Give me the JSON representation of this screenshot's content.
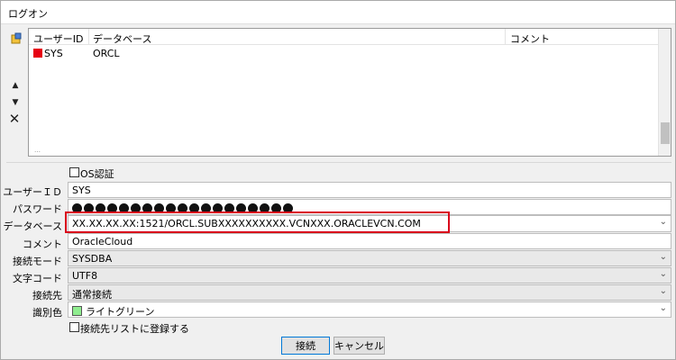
{
  "window": {
    "title": "ログオン"
  },
  "side_tools": {
    "move_up": "▲",
    "move_down": "▼",
    "delete": "✕"
  },
  "connection_list": {
    "columns": [
      "ユーザーID",
      "データベース",
      "コメント"
    ],
    "rows": [
      {
        "user_id": "SYS",
        "database": "ORCL",
        "comment": "",
        "color": "#e60012"
      }
    ]
  },
  "form": {
    "os_auth_label": "OS認証",
    "user_id_label": "ユーザーＩＤ",
    "user_id_value": "SYS",
    "password_label": "パスワード",
    "password_mask_count": 19,
    "database_label": "データベース",
    "database_value": "XX.XX.XX.XX:1521/ORCL.SUBXXXXXXXXXX.VCNXXX.ORACLEVCN.COM",
    "comment_label": "コメント",
    "comment_value": "OracleCloud",
    "connect_mode_label": "接続モード",
    "connect_mode_value": "SYSDBA",
    "charset_label": "文字コード",
    "charset_value": "UTF8",
    "destination_label": "接続先",
    "destination_value": "通常接続",
    "color_label": "識別色",
    "color_value": "ライトグリーン",
    "color_swatch": "#90ee90",
    "register_label": "接続先リストに登録する"
  },
  "buttons": {
    "connect": "接続",
    "cancel": "キャンセル"
  },
  "colors": {
    "highlight": "#d9001b"
  }
}
